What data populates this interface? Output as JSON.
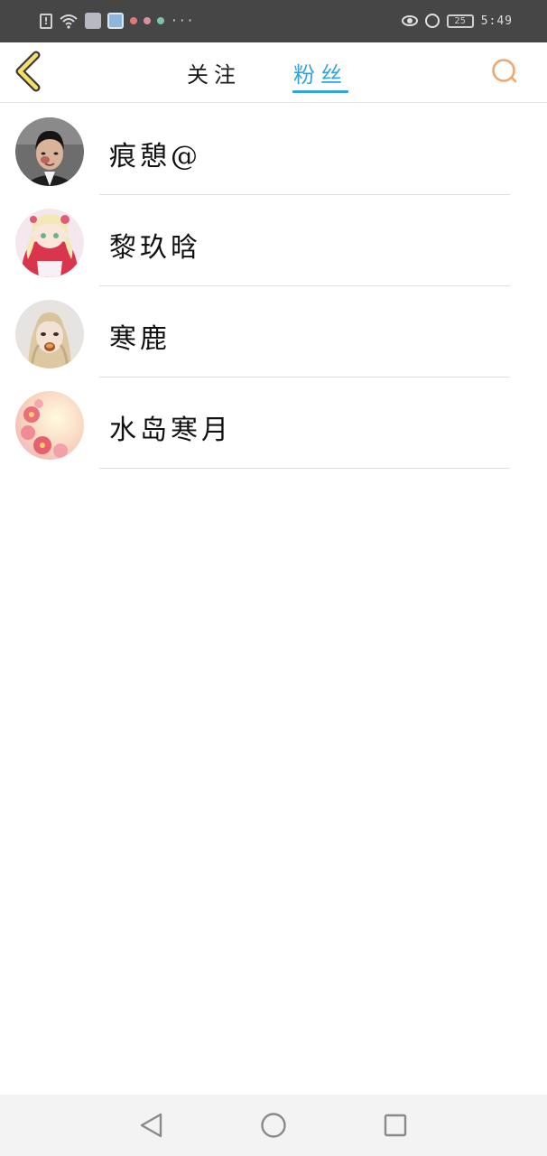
{
  "status_bar": {
    "notification_icon": "alert-icon",
    "wifi_icon": "wifi-icon",
    "more_indicator": "···",
    "battery_level": "25",
    "time": "5:49",
    "dot_colors": [
      "#e07a7a",
      "#d98fa0",
      "#7fc3a8"
    ]
  },
  "header": {
    "tabs": [
      {
        "label": "关注",
        "active": false
      },
      {
        "label": "粉丝",
        "active": true
      }
    ],
    "accent_color": "#33a3dc",
    "back_icon": "chevron-left-icon",
    "search_icon": "search-icon"
  },
  "fans": [
    {
      "name": "痕憩@",
      "avatar": "portrait-man"
    },
    {
      "name": "黎玖晗",
      "avatar": "anime-girl-pink"
    },
    {
      "name": "寒鹿",
      "avatar": "girl-blonde"
    },
    {
      "name": "水岛寒月",
      "avatar": "pink-flowers"
    }
  ],
  "nav_bar": {
    "back_icon": "triangle-back-icon",
    "home_icon": "circle-home-icon",
    "recent_icon": "square-recent-icon"
  }
}
